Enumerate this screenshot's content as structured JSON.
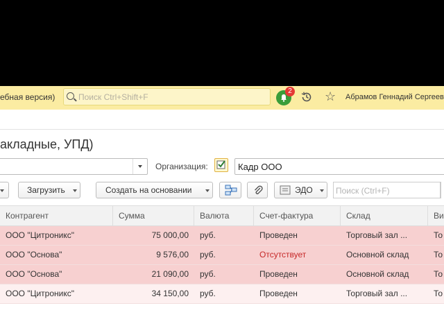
{
  "header": {
    "app_title_fragment": "ебная версия)",
    "search_placeholder": "Поиск Ctrl+Shift+F",
    "notifications_count": "2",
    "user_name": "Абрамов Геннадий Сергеевич"
  },
  "page": {
    "title": "акладные, УПД)"
  },
  "filters": {
    "organization_label": "Организация:",
    "organization_value": "Кадр ООО"
  },
  "toolbar": {
    "load_label": "Загрузить",
    "create_based_label": "Создать на основании",
    "edo_label": "ЭДО",
    "search_placeholder": "Поиск (Ctrl+F)"
  },
  "table": {
    "columns": [
      "Контрагент",
      "Сумма",
      "Валюта",
      "Счет-фактура",
      "Склад",
      "Ви"
    ],
    "rows": [
      {
        "counterparty": "ООО \"Цитроникс\"",
        "amount": "75 000,00",
        "currency": "руб.",
        "invoice": "Проведен",
        "warehouse": "Торговый зал ...",
        "extra": "То",
        "invoice_status": "ok",
        "state": "highlighted"
      },
      {
        "counterparty": "ООО \"Основа\"",
        "amount": "9 576,00",
        "currency": "руб.",
        "invoice": "Отсутствует",
        "warehouse": "Основной склад",
        "extra": "То",
        "invoice_status": "missing",
        "state": "highlighted"
      },
      {
        "counterparty": "ООО \"Основа\"",
        "amount": "21 090,00",
        "currency": "руб.",
        "invoice": "Проведен",
        "warehouse": "Основной склад",
        "extra": "То",
        "invoice_status": "ok",
        "state": "highlighted"
      },
      {
        "counterparty": "ООО \"Цитроникс\"",
        "amount": "34 150,00",
        "currency": "руб.",
        "invoice": "Проведен",
        "warehouse": "Торговый зал ...",
        "extra": "То",
        "invoice_status": "ok",
        "state": "normal"
      }
    ]
  },
  "colors": {
    "topbar_bg": "#fbeca2",
    "row_highlight": "#f7d0d0",
    "row_normal": "#fdf0f0",
    "status_missing": "#c62828",
    "bell_green": "#3a9d3a",
    "badge_red": "#e53935"
  },
  "icons": [
    "search-icon",
    "bell-icon",
    "history-icon",
    "star-icon",
    "checkbox-icon",
    "structure-icon",
    "paperclip-icon",
    "edo-icon"
  ]
}
